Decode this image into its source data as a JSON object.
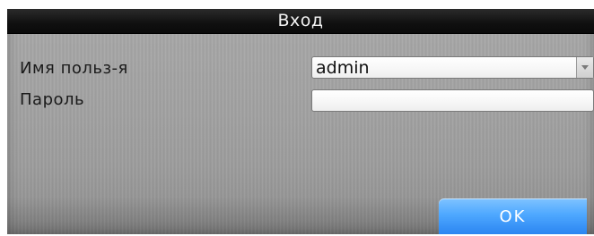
{
  "dialog": {
    "title": "Вход"
  },
  "form": {
    "username_label": "Имя польз-я",
    "username_value": "admin",
    "password_label": "Пароль",
    "password_value": ""
  },
  "actions": {
    "ok_label": "OK"
  },
  "icons": {
    "username_dropdown": "chevron-down-icon"
  },
  "colors": {
    "titlebar": "#111111",
    "dialog_background": "#a4a4a4",
    "ok_button": "#3b95ff"
  }
}
